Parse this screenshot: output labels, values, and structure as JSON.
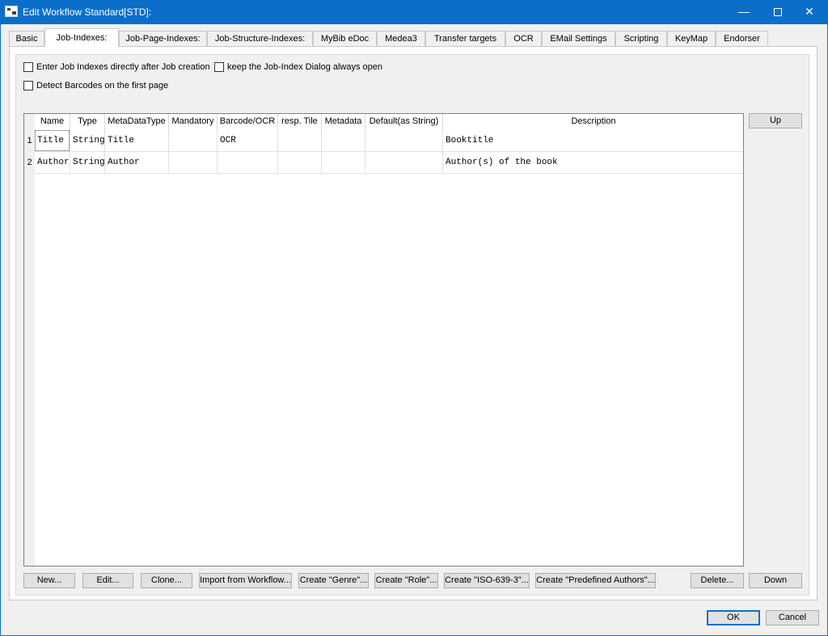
{
  "window": {
    "title": "Edit Workflow Standard[STD]:"
  },
  "tabs": [
    {
      "label": "Basic"
    },
    {
      "label": "Job-Indexes:"
    },
    {
      "label": "Job-Page-Indexes:"
    },
    {
      "label": "Job-Structure-Indexes:"
    },
    {
      "label": "MyBib eDoc"
    },
    {
      "label": "Medea3"
    },
    {
      "label": "Transfer targets"
    },
    {
      "label": "OCR"
    },
    {
      "label": "EMail Settings"
    },
    {
      "label": "Scripting"
    },
    {
      "label": "KeyMap"
    },
    {
      "label": "Endorser"
    }
  ],
  "options": {
    "enter_after_creation": "Enter Job Indexes directly after Job creation",
    "keep_dialog_open": "keep the Job-Index Dialog always open",
    "detect_barcodes": "Detect Barcodes on the first page"
  },
  "table": {
    "columns": [
      "Name",
      "Type",
      "MetaDataType",
      "Mandatory",
      "Barcode/OCR",
      "resp. Tile",
      "Metadata",
      "Default(as String)",
      "Description"
    ],
    "rows": [
      {
        "num": "1",
        "cells": [
          "Title",
          "String",
          "Title",
          "",
          "OCR",
          "",
          "",
          "",
          "Booktitle"
        ]
      },
      {
        "num": "2",
        "cells": [
          "Author",
          "String",
          "Author",
          "",
          "",
          "",
          "",
          "",
          "Author(s) of the book"
        ]
      }
    ]
  },
  "buttons": {
    "up": "Up",
    "new": "New...",
    "edit": "Edit...",
    "clone": "Clone...",
    "import": "Import from Workflow...",
    "create_genre": "Create \"Genre\"...",
    "create_role": "Create \"Role\"...",
    "create_iso": "Create \"ISO-639-3\"...",
    "create_authors": "Create \"Predefined Authors\"...",
    "delete": "Delete...",
    "down": "Down",
    "ok": "OK",
    "cancel": "Cancel"
  }
}
